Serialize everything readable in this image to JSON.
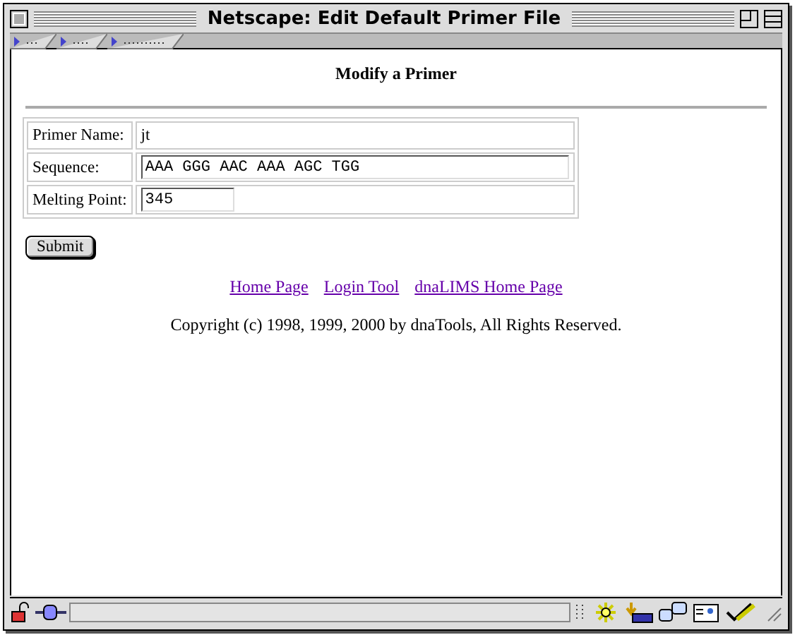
{
  "window": {
    "title": "Netscape: Edit Default Primer File"
  },
  "page": {
    "heading": "Modify a Primer"
  },
  "form": {
    "fields": [
      {
        "label": "Primer Name:",
        "kind": "text",
        "value": "jt"
      },
      {
        "label": "Sequence:",
        "kind": "long-input",
        "value": "AAA GGG AAC AAA AGC TGG"
      },
      {
        "label": "Melting Point:",
        "kind": "short-input",
        "value": "345"
      }
    ],
    "submit": "Submit"
  },
  "links": [
    "Home Page",
    "Login Tool",
    "dnaLIMS Home Page"
  ],
  "copyright": "Copyright (c) 1998, 1999, 2000 by dnaTools, All Rights Reserved.",
  "status_bar": {
    "level": 0
  }
}
